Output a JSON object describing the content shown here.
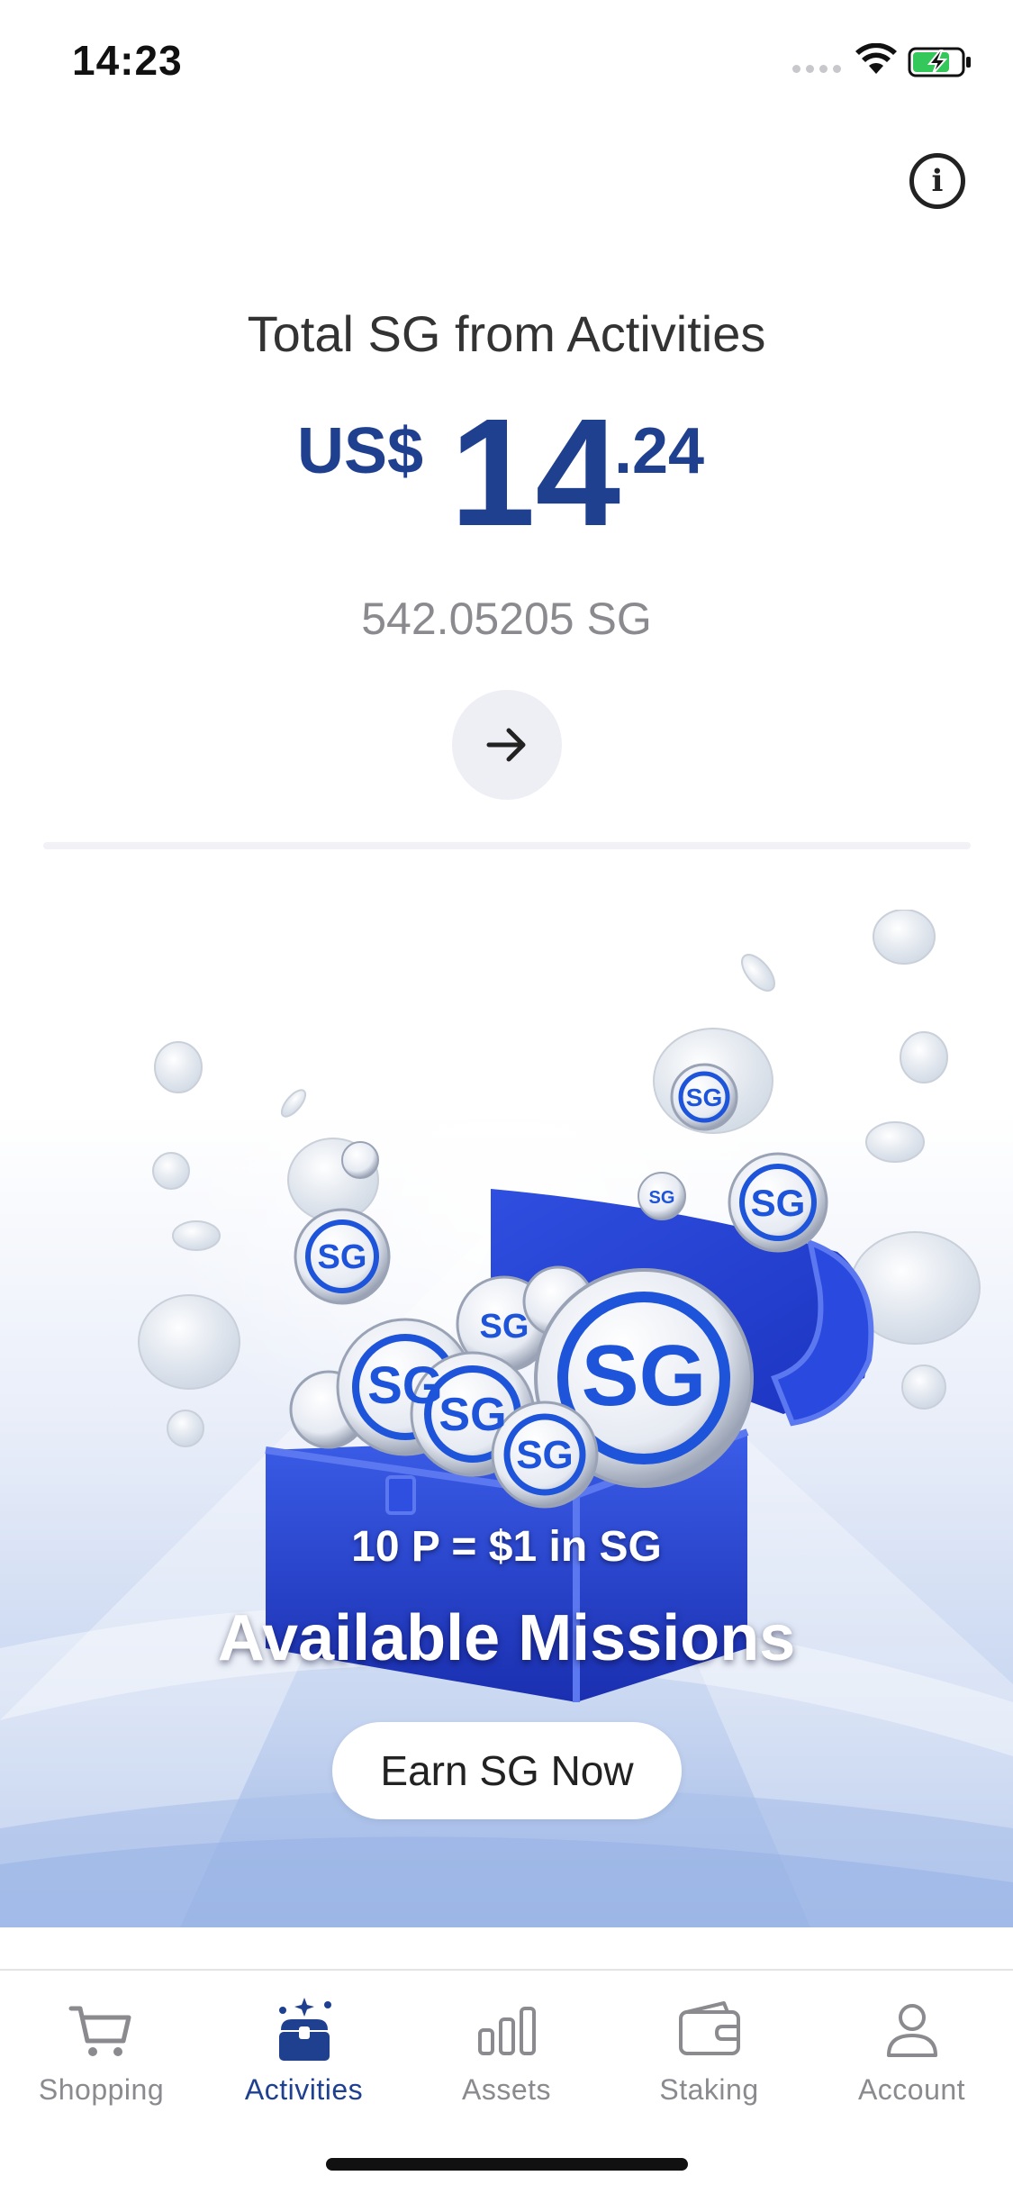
{
  "status_bar": {
    "time": "14:23"
  },
  "header": {
    "info_icon": "info-icon"
  },
  "summary": {
    "title": "Total SG from Activities",
    "currency": "US$",
    "amount_integer": "14",
    "amount_decimal": ".24",
    "sg_balance": "542.05205 SG",
    "action_icon": "arrow-right-icon"
  },
  "banner": {
    "rate": "10 P = $1 in SG",
    "title": "Available Missions",
    "button_label": "Earn SG Now",
    "coin_lettering": "SG"
  },
  "tabs": [
    {
      "label": "Shopping",
      "icon": "cart-icon",
      "active": false
    },
    {
      "label": "Activities",
      "icon": "treasure-chest-icon",
      "active": true
    },
    {
      "label": "Assets",
      "icon": "bar-chart-icon",
      "active": false
    },
    {
      "label": "Staking",
      "icon": "wallet-icon",
      "active": false
    },
    {
      "label": "Account",
      "icon": "person-icon",
      "active": false
    }
  ],
  "colors": {
    "accent": "#1f3f8f",
    "inactive": "#8a8a8f",
    "battery_green": "#34c759"
  }
}
